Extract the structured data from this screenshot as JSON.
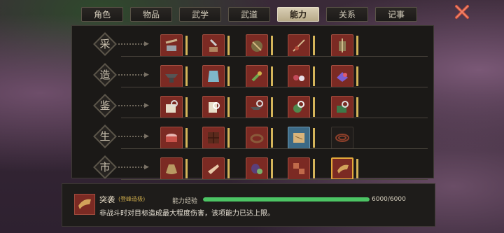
{
  "tabs": [
    {
      "label": "角色"
    },
    {
      "label": "物品"
    },
    {
      "label": "武学"
    },
    {
      "label": "武道"
    },
    {
      "label": "能力",
      "active": true
    },
    {
      "label": "关系"
    },
    {
      "label": "记事"
    }
  ],
  "close_icon": "close-x-icon",
  "rows": [
    {
      "label": "采",
      "skills": [
        "pickaxe-ore-icon",
        "axe-stump-icon",
        "fishing-basket-icon",
        "fishing-rod-icon",
        "spear-trap-icon"
      ]
    },
    {
      "label": "造",
      "skills": [
        "anvil-icon",
        "armor-vest-icon",
        "herb-bundle-icon",
        "gem-berries-icon",
        "crystal-ore-icon"
      ]
    },
    {
      "label": "鉴",
      "skills": [
        "book-magnifier-icon",
        "scroll-magnifier-icon",
        "anvil-magnifier-icon",
        "potion-magnifier-icon",
        "gem-magnifier-icon"
      ]
    },
    {
      "label": "生",
      "skills": [
        "drum-icon",
        "chocolate-bar-icon",
        "coiled-rope-icon",
        "map-scroll-icon",
        "whip-icon"
      ]
    },
    {
      "label": "市",
      "skills": [
        "money-bag-icon",
        "pointing-hand-icon",
        "eggplant-bowl-icon",
        "token-chain-icon",
        "horn-icon"
      ]
    }
  ],
  "selected_skill": {
    "name": "突袭",
    "subtitle": "(登峰造极)",
    "description": "非战斗时对目标造成最大程度伤害，该项能力已达上限。",
    "icon": "horn-icon",
    "exp_label": "能力经验",
    "exp_value": "6000/6000",
    "exp_fraction": 1.0
  },
  "colors": {
    "slot_red": "#7b2a23",
    "slot_blue": "#3c6a86",
    "accent_gold": "#e4a93b",
    "exp_green": "#4cc464"
  }
}
